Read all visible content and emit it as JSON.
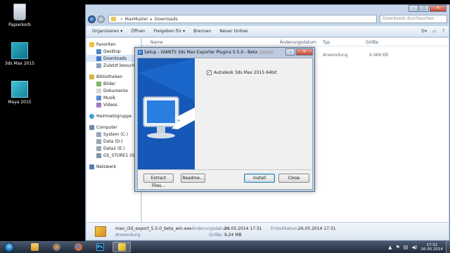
{
  "desktop": {
    "icons": [
      {
        "label": "Papierkorb",
        "icon": "recycle-bin-icon"
      },
      {
        "label": "3ds Max 2015",
        "icon": "3ds-max-icon"
      },
      {
        "label": "Maya 2015",
        "icon": "maya-icon"
      }
    ]
  },
  "explorer": {
    "breadcrumb": [
      "MaxMuster",
      "Downloads"
    ],
    "search_placeholder": "Downloads durchsuchen",
    "title_buttons": [
      "–",
      "□",
      "✕"
    ],
    "commands": [
      "Organisieren ▾",
      "Öffnen",
      "Freigeben für ▾",
      "Brennen",
      "Neuer Ordner"
    ],
    "nav": {
      "favorites": {
        "label": "Favoriten",
        "items": [
          "Desktop",
          "Downloads",
          "Zuletzt besucht"
        ]
      },
      "libraries": {
        "label": "Bibliotheken",
        "items": [
          "Bilder",
          "Dokumente",
          "Musik",
          "Videos"
        ]
      },
      "homegroup": "Heimnetzgruppe",
      "computer": {
        "label": "Computer",
        "items": [
          "System (C:)",
          "Data (D:)",
          "Data2 (E:)",
          "GS_STORE1 (G:)"
        ]
      },
      "network": "Netzwerk"
    },
    "columns": [
      "Name",
      "Änderungsdatum",
      "Typ",
      "Größe"
    ],
    "file_row": {
      "type": "Anwendung",
      "size": "9.468 KB"
    },
    "details": {
      "filename": "max_i3d_export_5.5.0_beta_win.exe",
      "type": "Anwendung",
      "modified_label": "Änderungsdatum:",
      "modified": "26.05.2014 17:31",
      "size_label": "Größe:",
      "size": "9,24 MB",
      "created_label": "Erstelldatum:",
      "created": "26.05.2014 17:31"
    }
  },
  "setup": {
    "title": "Setup - GIANTS 3ds Max Exporter Plugins 5.5.0 - Beta",
    "option_label": "Autodesk 3ds Max 2015 64bit",
    "option_checked": true,
    "buttons": {
      "extract": "Extract Files...",
      "readme": "Readme...",
      "install": "Install",
      "close": "Close"
    }
  },
  "taskbar": {
    "apps": [
      "explorer-icon",
      "media-player-icon",
      "firefox-icon",
      "photoshop-icon",
      "setup-icon"
    ],
    "photoshop_label": "Ps",
    "time": "17:31",
    "date": "26.05.2014"
  },
  "colors": {
    "accent": "#1f6cd0",
    "taskbar": "#2b3748",
    "window_frame": "#c5d6ea"
  }
}
